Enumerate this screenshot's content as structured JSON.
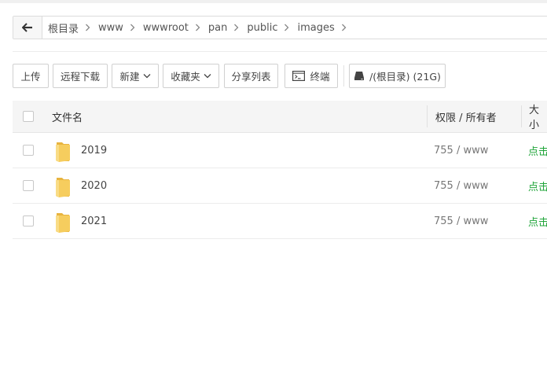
{
  "breadcrumb": {
    "items": [
      {
        "label": "根目录"
      },
      {
        "label": "www"
      },
      {
        "label": "wwwroot"
      },
      {
        "label": "pan"
      },
      {
        "label": "public"
      },
      {
        "label": "images"
      }
    ]
  },
  "toolbar": {
    "upload_label": "上传",
    "remote_download_label": "远程下载",
    "new_label": "新建",
    "favorites_label": "收藏夹",
    "share_list_label": "分享列表",
    "terminal_label": "终端",
    "disk_label": "/(根目录) (21G)"
  },
  "table": {
    "headers": {
      "name": "文件名",
      "permission": "权限 / 所有者",
      "size": "大小"
    },
    "rows": [
      {
        "name": "2019",
        "permission": "755 / www",
        "size_action": "点击计算"
      },
      {
        "name": "2020",
        "permission": "755 / www",
        "size_action": "点击计算"
      },
      {
        "name": "2021",
        "permission": "755 / www",
        "size_action": "点击计算"
      }
    ]
  },
  "colors": {
    "accent_green": "#20a53a",
    "folder_yellow": "#f6cd5e"
  },
  "icons": {
    "back": "arrow-left-icon",
    "separator": "chevron-right-icon",
    "dropdown": "chevron-down-icon",
    "terminal": "terminal-icon",
    "disk": "disk-icon",
    "folder": "folder-icon"
  }
}
